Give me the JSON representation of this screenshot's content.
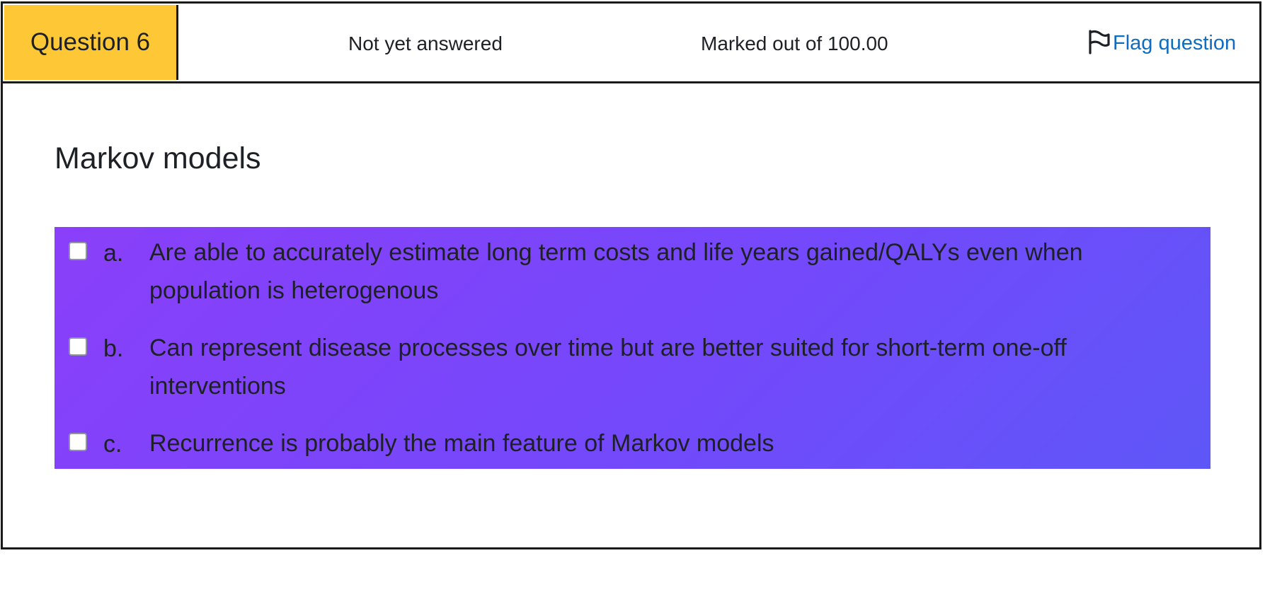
{
  "question": {
    "number_label": "Question 6",
    "state": "Not yet answered",
    "grade": "Marked out of 100.00",
    "flag_label": "Flag question",
    "flag_icon": "flag-outline-icon",
    "text": "Markov models"
  },
  "answers": [
    {
      "letter": "a.",
      "text": "Are able to accurately estimate long term costs and life years gained/QALYs even when population is heterogenous",
      "checked": false
    },
    {
      "letter": "b.",
      "text": "Can represent disease processes over time but are better suited for short-term one-off interventions",
      "checked": false
    },
    {
      "letter": "c.",
      "text": "Recurrence is probably the main feature of Markov models",
      "checked": false
    }
  ],
  "colors": {
    "question_badge": "#fdc736",
    "link": "#0f6cbf",
    "answer_gradient_start": "#8a3ff9",
    "answer_gradient_end": "#5e57f8",
    "border": "#1a1a1a"
  }
}
